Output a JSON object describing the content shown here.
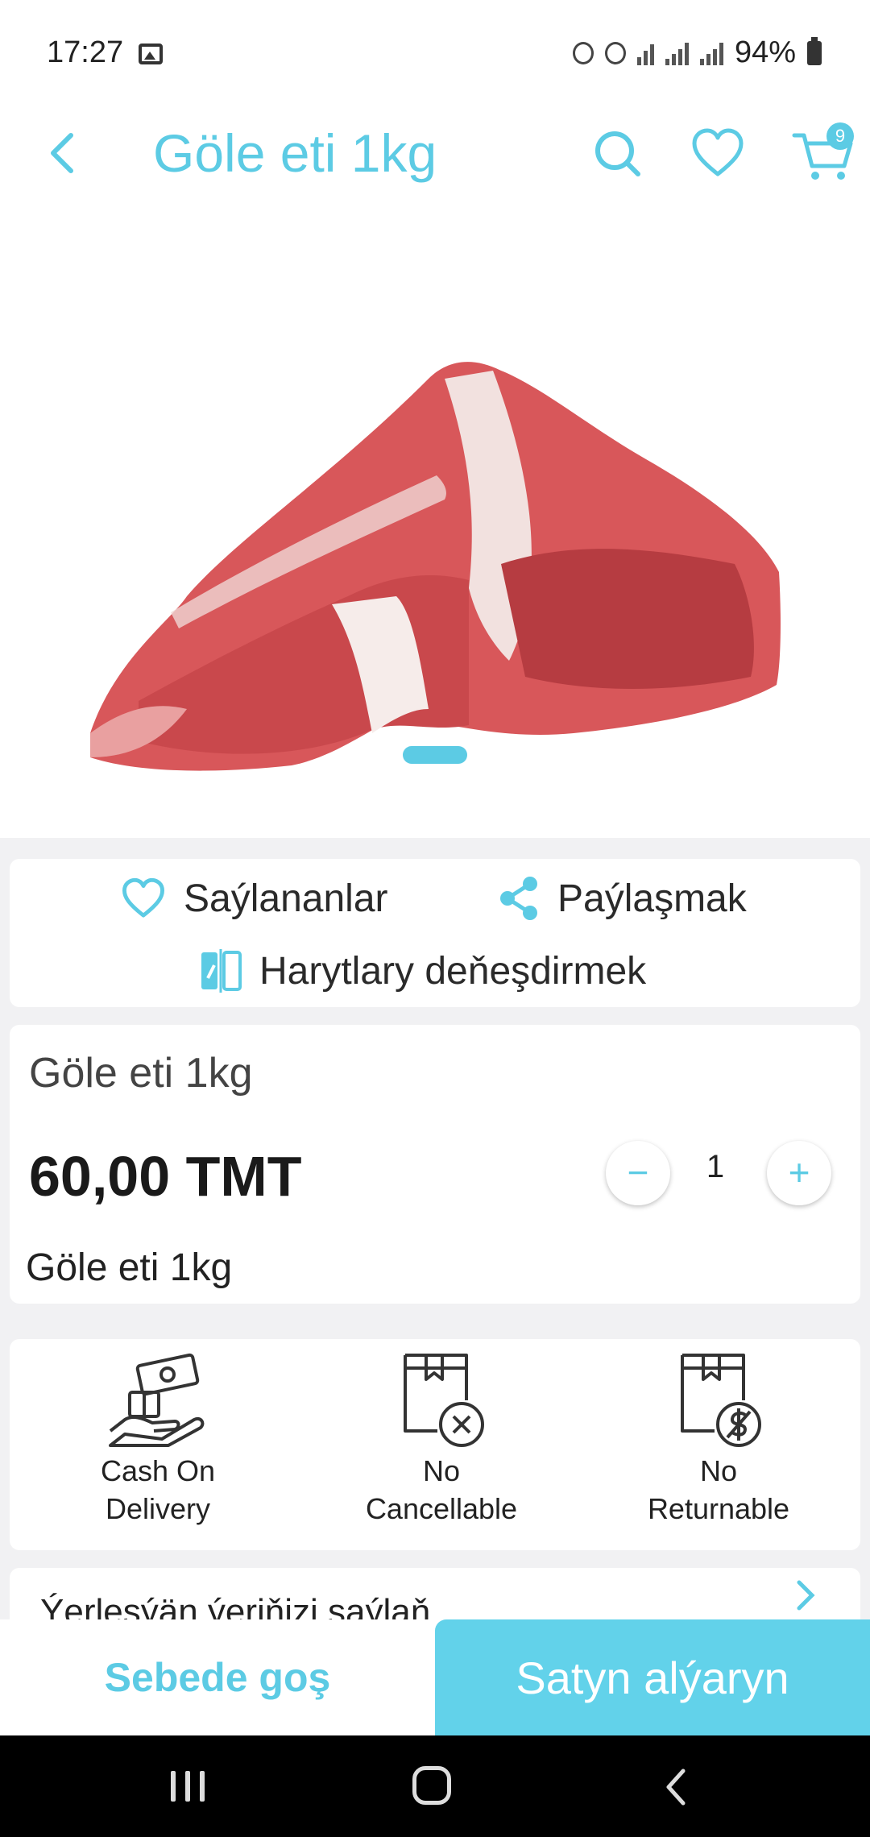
{
  "status": {
    "time": "17:27",
    "battery": "94%"
  },
  "header": {
    "title": "Göle eti 1kg",
    "cart_count": "9"
  },
  "gallery": {
    "image_alt": "Göle eti 1kg product photo",
    "page_index": 1
  },
  "actions": {
    "favorites_label": "Saýlananlar",
    "share_label": "Paýlaşmak",
    "compare_label": "Harytlary deňeşdirmek"
  },
  "product": {
    "name": "Göle eti 1kg",
    "price": "60,00 TMT",
    "quantity": "1",
    "description": "Göle eti 1kg"
  },
  "features": [
    {
      "label_line1": "Cash On",
      "label_line2": "Delivery",
      "icon": "cash-on-delivery-icon"
    },
    {
      "label_line1": "No",
      "label_line2": "Cancellable",
      "icon": "no-cancel-icon"
    },
    {
      "label_line1": "No",
      "label_line2": "Returnable",
      "icon": "no-return-icon"
    }
  ],
  "location": {
    "label": "Ýerleşýän ýeriňizi saýlaň"
  },
  "bottom": {
    "add_to_cart": "Sebede goş",
    "buy_now": "Satyn alýaryn"
  },
  "colors": {
    "accent": "#5ccbe4",
    "buy_button": "#62d2ea"
  }
}
